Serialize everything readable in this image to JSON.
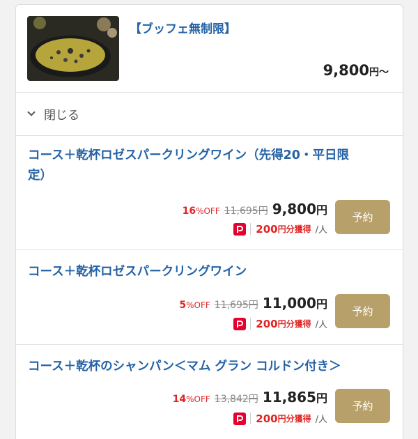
{
  "course": {
    "title": "【ブッフェ無制限】",
    "price": "9,800",
    "price_unit": "円〜"
  },
  "toggle": {
    "icon": "chevron-down-icon",
    "label": "閉じる"
  },
  "plans": [
    {
      "title_line1": "コース＋乾杯ロゼスパークリングワイン（先得20・平日限",
      "title_line2": "定）",
      "off_num": "16",
      "off_txt": "%OFF",
      "orig": "11,695円",
      "price": "9,800",
      "price_unit": "円",
      "points_num": "200",
      "points_txt": "円分獲得",
      "per": "/人",
      "button": "予約"
    },
    {
      "title_line1": "コース＋乾杯ロゼスパークリングワイン",
      "off_num": "5",
      "off_txt": "%OFF",
      "orig": "11,695円",
      "price": "11,000",
      "price_unit": "円",
      "points_num": "200",
      "points_txt": "円分獲得",
      "per": "/人",
      "button": "予約"
    },
    {
      "title_line1": "コース＋乾杯のシャンパン＜マム グラン コルドン付き＞",
      "off_num": "14",
      "off_txt": "%OFF",
      "orig": "13,842円",
      "price": "11,865",
      "price_unit": "円",
      "points_num": "200",
      "points_txt": "円分獲得",
      "per": "/人",
      "button": "予約"
    }
  ],
  "colors": {
    "link": "#2563a6",
    "discount": "#e02424",
    "button": "#b8a06a",
    "paypay": "#e6002d"
  }
}
